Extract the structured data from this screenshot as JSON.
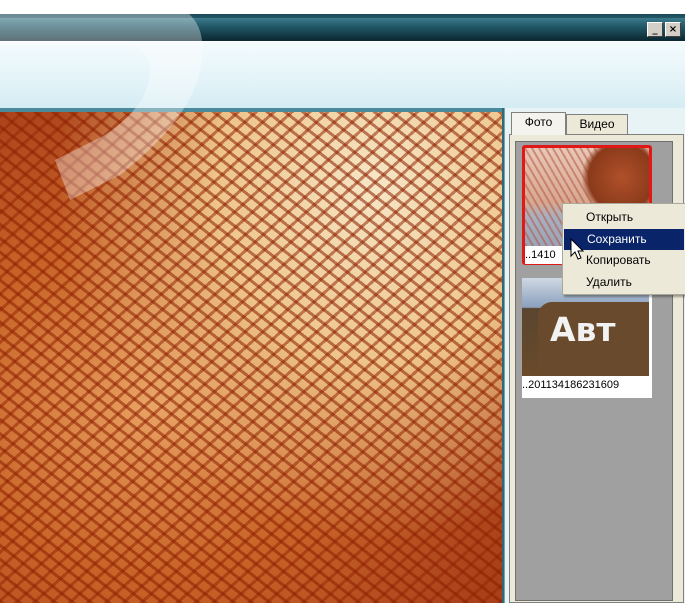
{
  "window": {
    "min_glyph": "_",
    "close_glyph": "×"
  },
  "tabs": [
    {
      "label": "Фото",
      "active": true
    },
    {
      "label": "Видео",
      "active": false
    }
  ],
  "thumbnails": [
    {
      "caption": "..1410",
      "selected": true
    },
    {
      "caption": "..201134186231609",
      "sign_text": "Авт",
      "selected": false
    }
  ],
  "context_menu": {
    "items": [
      {
        "label": "Открыть"
      },
      {
        "label": "Сохранить",
        "highlighted": true
      },
      {
        "label": "Копировать"
      },
      {
        "label": "Удалить"
      }
    ]
  },
  "colors": {
    "selection_border": "#e01818",
    "menu_highlight": "#0a246a",
    "titlebar": "#1a4a57"
  }
}
